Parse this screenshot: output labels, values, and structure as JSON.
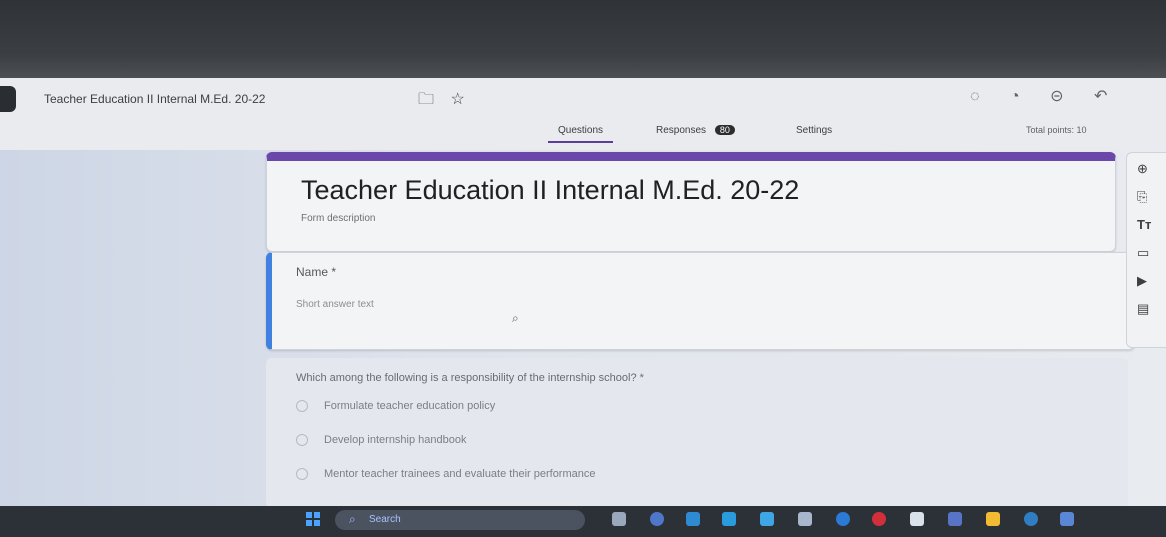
{
  "app": {
    "form_name": "Teacher Education II Internal M.Ed. 20-22",
    "top_icons": [
      "folder-icon",
      "star-icon"
    ],
    "right_icons": [
      "palette-icon",
      "preview-eye-icon",
      "link-icon",
      "undo-icon"
    ]
  },
  "tabs": [
    {
      "label": "Questions",
      "active": true
    },
    {
      "label": "Responses",
      "badge": "80"
    },
    {
      "label": "Settings"
    }
  ],
  "total_points": "Total points: 10",
  "form": {
    "title": "Teacher Education II Internal M.Ed. 20-22",
    "description": "Form description"
  },
  "questions": [
    {
      "label": "Name *",
      "placeholder": "Short answer text"
    },
    {
      "label": "Which among the following is a responsibility of the internship school? *",
      "options": [
        "Formulate teacher education policy",
        "Develop internship handbook",
        "Mentor teacher trainees and evaluate their performance"
      ]
    }
  ],
  "side_toolbar": [
    "add-question-icon",
    "import-icon",
    "title-text-icon",
    "image-icon",
    "video-icon",
    "section-icon"
  ],
  "taskbar": {
    "search": "Search",
    "app_icons": [
      "files-icon",
      "chat-icon",
      "edge-icon",
      "folder-icon",
      "store-icon",
      "mail-icon",
      "teams-icon",
      "office-icon",
      "app-icon",
      "explorer-icon",
      "weather-icon",
      "settings-icon"
    ]
  },
  "colors": {
    "accent_purple": "#6a47a8",
    "accent_blue": "#3f80e0"
  }
}
